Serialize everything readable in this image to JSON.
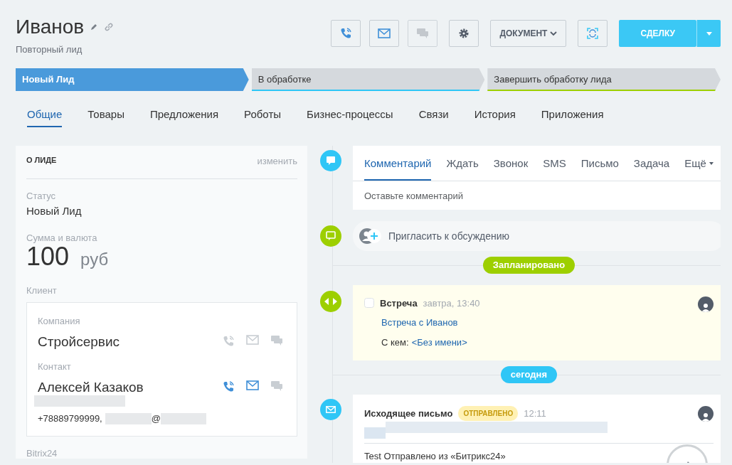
{
  "header": {
    "title": "Иванов",
    "subtitle": "Повторный лид",
    "document_button": "ДОКУМЕНТ",
    "primary_button": "СДЕЛКУ",
    "tool_buttons": [
      {
        "kind": "phone",
        "disabled": false
      },
      {
        "kind": "mail",
        "disabled": false
      },
      {
        "kind": "chat",
        "disabled": true
      }
    ]
  },
  "stages": [
    {
      "label": "Новый Лид",
      "selected": true,
      "color": "#4a9adb"
    },
    {
      "label": "В обработке",
      "selected": false,
      "color": "#2fc6f6"
    },
    {
      "label": "Завершить обработку лида",
      "selected": false,
      "color": "#9dcf00"
    }
  ],
  "tabs": [
    {
      "label": "Общие",
      "selected": true
    },
    {
      "label": "Товары",
      "selected": false
    },
    {
      "label": "Предложения",
      "selected": false
    },
    {
      "label": "Роботы",
      "selected": false
    },
    {
      "label": "Бизнес-процессы",
      "selected": false
    },
    {
      "label": "Связи",
      "selected": false
    },
    {
      "label": "История",
      "selected": false
    },
    {
      "label": "Приложения",
      "selected": false
    }
  ],
  "lead_panel": {
    "title": "О ЛИДЕ",
    "edit": "изменить",
    "status_label": "Статус",
    "status": "Новый Лид",
    "sum_label": "Сумма и валюта",
    "amount": "100",
    "currency": "руб",
    "client_label": "Клиент",
    "client": [
      {
        "label": "Компания",
        "name": "Стройсервис",
        "channels": [
          {
            "kind": "phone",
            "active": false
          },
          {
            "kind": "mail",
            "active": false
          },
          {
            "kind": "chat",
            "active": false
          }
        ]
      },
      {
        "label": "Контакт",
        "name": "Алексей Казаков",
        "phone": "+78889799999,",
        "email_at": "@",
        "channels": [
          {
            "kind": "phone",
            "active": true
          },
          {
            "kind": "mail",
            "active": true
          },
          {
            "kind": "chat",
            "active": false
          }
        ]
      }
    ],
    "section_label": "Bitrix24"
  },
  "timeline": {
    "composer_tabs": [
      {
        "label": "Комментарий",
        "selected": true
      },
      {
        "label": "Ждать",
        "selected": false
      },
      {
        "label": "Звонок",
        "selected": false
      },
      {
        "label": "SMS",
        "selected": false
      },
      {
        "label": "Письмо",
        "selected": false
      },
      {
        "label": "Задача",
        "selected": false
      }
    ],
    "more": "Ещё",
    "placeholder": "Оставьте комментарий",
    "invite": "Пригласить к обсуждению",
    "items": [
      {
        "kind": "separator",
        "label": "Запланировано",
        "color": "#9dcf00"
      },
      {
        "kind": "meeting",
        "title": "Встреча",
        "time": "завтра, 13:40",
        "checked": false,
        "link": "Встреча с Иванов",
        "with_label": "С кем:",
        "with_value": "<Без имени>"
      },
      {
        "kind": "separator",
        "label": "сегодня",
        "color": "#2fc6f6"
      },
      {
        "kind": "email",
        "title": "Исходящее письмо",
        "status": "ОТПРАВЛЕНО",
        "time": "12:11",
        "body": "Test Отправлено из «Битрикс24»"
      }
    ]
  }
}
